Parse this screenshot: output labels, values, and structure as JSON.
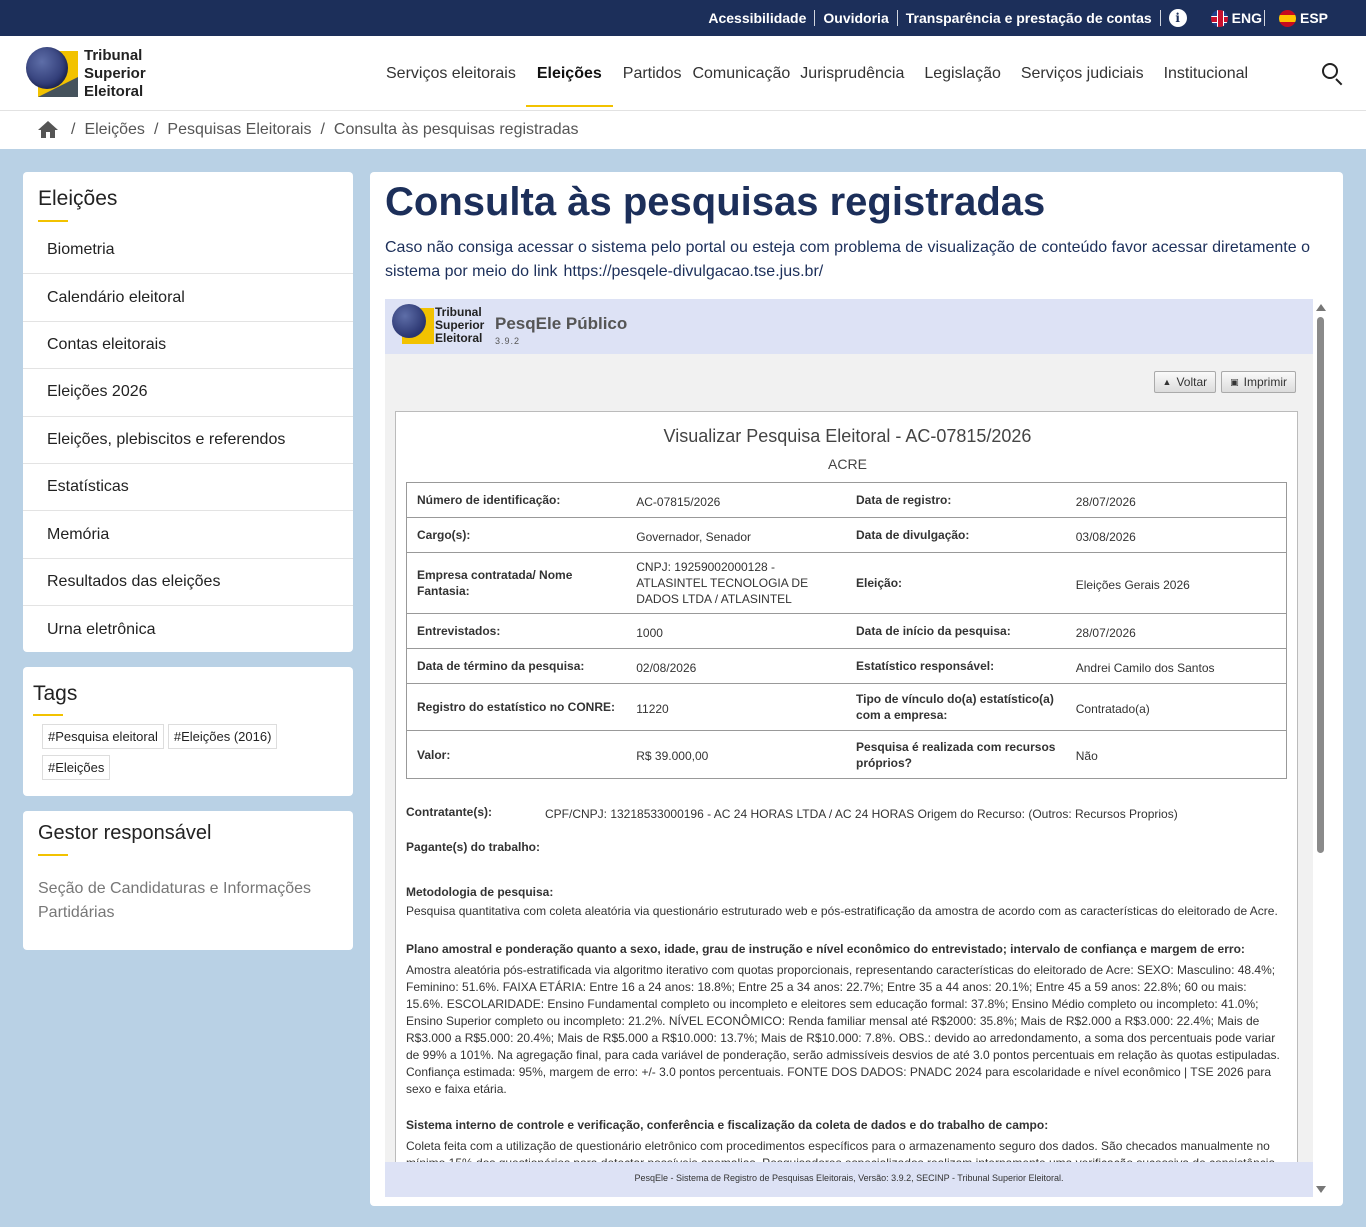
{
  "topbar": {
    "links": [
      "Acessibilidade",
      "Ouvidoria",
      "Transparência e prestação de contas"
    ],
    "lang_en": "ENG",
    "lang_es": "ESP"
  },
  "logo": {
    "line1": "Tribunal",
    "line2": "Superior",
    "line3": "Eleitoral"
  },
  "nav": [
    "Serviços eleitorais",
    "Eleições",
    "Partidos",
    "Comunicação",
    "Jurisprudência",
    "Legislação",
    "Serviços judiciais",
    "Institucional"
  ],
  "nav_active": "Eleições",
  "breadcrumb": [
    "Eleições",
    "Pesquisas Eleitorais",
    "Consulta às pesquisas registradas"
  ],
  "sidebar": {
    "title": "Eleições",
    "items": [
      "Biometria",
      "Calendário eleitoral",
      "Contas eleitorais",
      "Eleições 2026",
      "Eleições, plebiscitos e referendos",
      "Estatísticas",
      "Memória",
      "Resultados das eleições",
      "Urna eletrônica"
    ]
  },
  "tags": {
    "title": "Tags",
    "items": [
      "#Pesquisa eleitoral",
      "#Eleições (2016)",
      "#Eleições"
    ]
  },
  "gestor": {
    "title": "Gestor responsável",
    "text": "Seção de Candidaturas e Informações Partidárias"
  },
  "main": {
    "title": "Consulta às pesquisas registradas",
    "intro": "Caso não consiga acessar o sistema pelo portal ou esteja com problema de visualização de conteúdo favor acessar diretamente o sistema por meio do link",
    "url": "https://pesqele-divulgacao.tse.jus.br/"
  },
  "pesqele": {
    "app_name": "PesqEle Público",
    "version": "3.9.2",
    "btn_back": "Voltar",
    "btn_print": "Imprimir",
    "card_title": "Visualizar Pesquisa Eleitoral - AC-07815/2026",
    "card_sub": "ACRE",
    "rows": [
      [
        "Número de identificação:",
        "AC-07815/2026",
        "Data de registro:",
        "28/07/2026"
      ],
      [
        "Cargo(s):",
        "Governador, Senador",
        "Data de divulgação:",
        "03/08/2026"
      ],
      [
        "Empresa contratada/ Nome Fantasia:",
        "CNPJ: 19259002000128 - ATLASINTEL TECNOLOGIA DE DADOS LTDA / ATLASINTEL",
        "Eleição:",
        "Eleições Gerais 2026"
      ],
      [
        "Entrevistados:",
        "1000",
        "Data de início da pesquisa:",
        "28/07/2026"
      ],
      [
        "Data de término da pesquisa:",
        "02/08/2026",
        "Estatístico responsável:",
        "Andrei Camilo dos Santos"
      ],
      [
        "Registro do estatístico no CONRE:",
        "11220",
        "Tipo de vínculo do(a) estatístico(a) com a empresa:",
        "Contratado(a)"
      ],
      [
        "Valor:",
        "R$ 39.000,00",
        "Pesquisa é realizada com recursos próprios?",
        "Não"
      ]
    ],
    "contratante_label": "Contratante(s):",
    "contratante_value": "CPF/CNPJ: 13218533000196 - AC 24 HORAS LTDA / AC 24 HORAS Origem do Recurso: (Outros: Recursos Proprios)",
    "pagante_label": "Pagante(s) do trabalho:",
    "metodologia_label": "Metodologia de pesquisa:",
    "metodologia_text": "Pesquisa quantitativa com coleta aleatória via questionário estruturado web e pós-estratificação da amostra de acordo com as características do eleitorado de Acre.",
    "plano_label": "Plano amostral e ponderação quanto a sexo, idade, grau de instrução e nível econômico do entrevistado; intervalo de confiança e margem de erro:",
    "plano_text": "Amostra aleatória pós-estratificada via algoritmo iterativo com quotas proporcionais, representando características do eleitorado de Acre: SEXO: Masculino: 48.4%; Feminino: 51.6%. FAIXA ETÁRIA: Entre 16 a 24 anos: 18.8%; Entre 25 a 34 anos: 22.7%; Entre 35 a 44 anos: 20.1%; Entre 45 a 59 anos: 22.8%; 60 ou mais: 15.6%. ESCOLARIDADE: Ensino Fundamental completo ou incompleto e eleitores sem educação formal: 37.8%; Ensino Médio completo ou incompleto: 41.0%; Ensino Superior completo ou incompleto: 21.2%. NÍVEL ECONÔMICO: Renda familiar mensal até R$2000: 35.8%; Mais de R$2.000 a R$3.000: 22.4%; Mais de R$3.000 a R$5.000: 20.4%; Mais de R$5.000 a R$10.000: 13.7%; Mais de R$10.000: 7.8%. OBS.: devido ao arredondamento, a soma dos percentuais pode variar de 99% a 101%. Na agregação final, para cada variável de ponderação, serão admissíveis desvios de até 3.0 pontos percentuais em relação às quotas estipuladas. Confiança estimada: 95%, margem de erro: +/- 3.0 pontos percentuais. FONTE DOS DADOS: PNADC 2024 para escolaridade e nível econômico | TSE 2026 para sexo e faixa etária.",
    "sistema_label": "Sistema interno de controle e verificação, conferência e fiscalização da coleta de dados e do trabalho de campo:",
    "sistema_text": "Coleta feita com a utilização de questionário eletrônico com procedimentos específicos para o armazenamento seguro dos dados. São checados manualmente no mínimo 15% dos questionários para detectar possíveis anomalias. Pesquisadores especializados realizam internamente uma verificação sucessiva de consistência.",
    "footer": "PesqEle - Sistema de Registro de Pesquisas Eleitorais, Versão: 3.9.2, SECINP - Tribunal Superior Eleitoral."
  }
}
